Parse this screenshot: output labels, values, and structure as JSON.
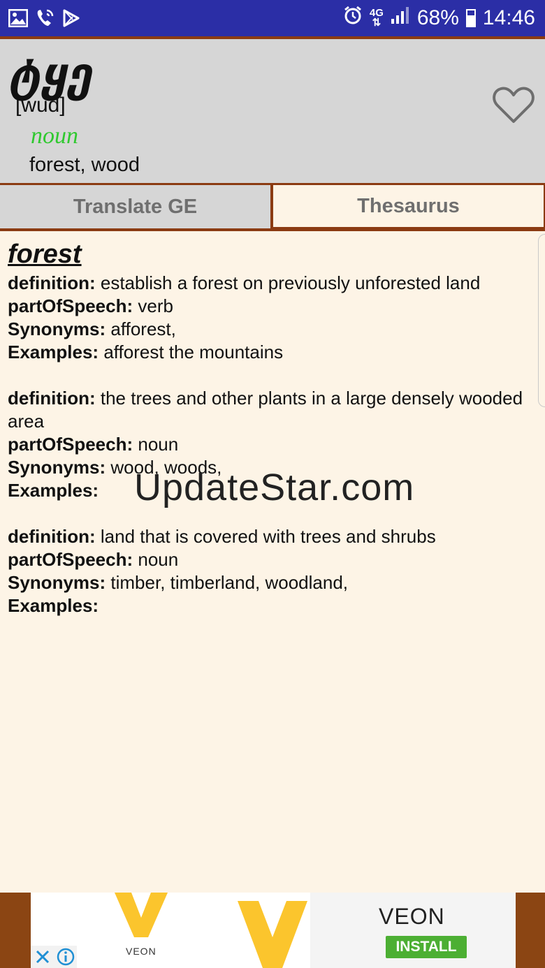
{
  "status_bar": {
    "battery": "68%",
    "time": "14:46",
    "network": "4G"
  },
  "header": {
    "word": "ტყე",
    "pronunciation": "[wud]",
    "part_of_speech": "noun",
    "translation": "forest, wood"
  },
  "tabs": [
    {
      "label": "Translate GE",
      "active": false
    },
    {
      "label": "Thesaurus",
      "active": true
    }
  ],
  "thesaurus": {
    "headword": "forest",
    "labels": {
      "definition": "definition:",
      "pos": "partOfSpeech:",
      "synonyms": "Synonyms:",
      "examples": "Examples:"
    },
    "entries": [
      {
        "definition": "establish a forest on previously unforested land",
        "partOfSpeech": "verb",
        "synonyms": "afforest,",
        "examples": "afforest the mountains"
      },
      {
        "definition": "the trees and other plants in a large densely wooded area",
        "partOfSpeech": "noun",
        "synonyms": "wood, woods,",
        "examples": ""
      },
      {
        "definition": "land that is covered with trees and shrubs",
        "partOfSpeech": "noun",
        "synonyms": "timber, timberland, woodland,",
        "examples": ""
      }
    ]
  },
  "watermark": "UpdateStar.com",
  "ad": {
    "brand_small": "VEON",
    "brand": "VEON",
    "button": "INSTALL"
  },
  "colors": {
    "status_bar": "#2b2ea6",
    "accent_brown": "#8b3b12",
    "header_bg": "#d6d6d6",
    "content_bg": "#fdf4e6",
    "pos_green": "#2fc92f",
    "install_green": "#4caf33",
    "veon_yellow": "#fbc52d"
  }
}
